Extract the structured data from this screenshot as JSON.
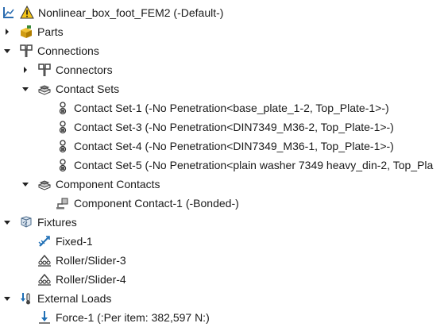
{
  "tree": {
    "root": {
      "label": "Nonlinear_box_foot_FEM2 (-Default-)"
    },
    "parts": {
      "label": "Parts"
    },
    "connections": {
      "label": "Connections",
      "connectors": {
        "label": "Connectors"
      },
      "contact_sets": {
        "label": "Contact Sets",
        "items": [
          {
            "label": "Contact Set-1 (-No Penetration<base_plate_1-2, Top_Plate-1>-)"
          },
          {
            "label": "Contact Set-3 (-No Penetration<DIN7349_M36-2, Top_Plate-1>-)"
          },
          {
            "label": "Contact Set-4 (-No Penetration<DIN7349_M36-1, Top_Plate-1>-)"
          },
          {
            "label": "Contact Set-5 (-No Penetration<plain washer 7349 heavy_din-2, Top_Pla"
          }
        ]
      },
      "component_contacts": {
        "label": "Component Contacts",
        "items": [
          {
            "label": "Component Contact-1 (-Bonded-)"
          }
        ]
      }
    },
    "fixtures": {
      "label": "Fixtures",
      "items": [
        {
          "label": "Fixed-1"
        },
        {
          "label": "Roller/Slider-3"
        },
        {
          "label": "Roller/Slider-4"
        }
      ]
    },
    "external_loads": {
      "label": "External Loads",
      "items": [
        {
          "label": "Force-1 (:Per item: 382,597 N:)"
        }
      ]
    }
  }
}
